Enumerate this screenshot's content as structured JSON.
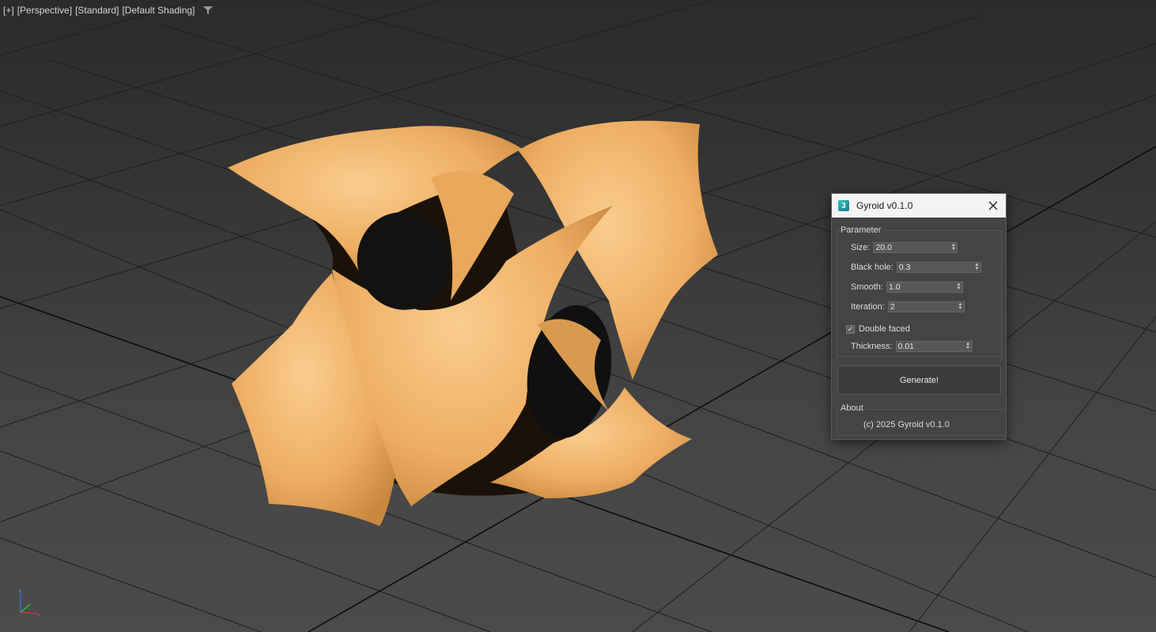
{
  "viewport": {
    "labels": [
      "[+]",
      "[Perspective]",
      "[Standard]",
      "[Default Shading]"
    ],
    "filter_icon": "filter-icon",
    "axis_icon": "axis-tripod-icon",
    "model_color": "#f0b46a"
  },
  "dialog": {
    "title": "Gyroid v0.1.0",
    "app_icon_glyph": "3",
    "close_icon": "close-icon",
    "parameter_group": {
      "label": "Parameter",
      "fields": [
        {
          "label": "Size:",
          "value": "20.0"
        },
        {
          "label": "Black hole:",
          "value": "0.3"
        },
        {
          "label": "Smooth:",
          "value": "1.0"
        },
        {
          "label": "Iteration:",
          "value": "2"
        }
      ],
      "double_faced": {
        "label": "Double faced",
        "checked": true
      },
      "thickness": {
        "label": "Thickness:",
        "value": "0.01"
      }
    },
    "generate_button": "Generate!",
    "about_group": {
      "label": "About",
      "text": "(c) 2025 Gyroid v0.1.0"
    }
  }
}
